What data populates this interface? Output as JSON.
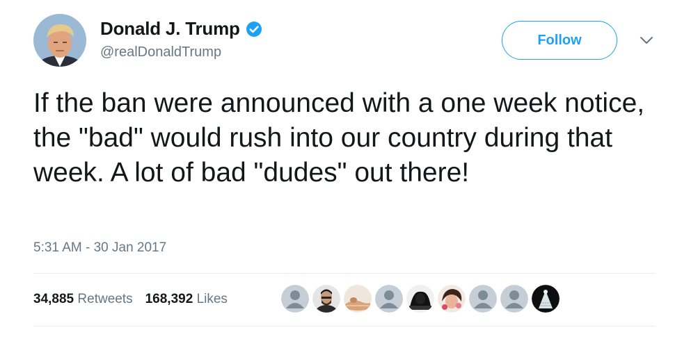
{
  "author": {
    "display_name": "Donald J. Trump",
    "handle": "@realDonaldTrump",
    "verified_icon": "verified-badge-icon"
  },
  "follow_label": "Follow",
  "menu_icon": "chevron-down-icon",
  "tweet_text": "If the ban were announced with a one week notice, the \"bad\" would rush into our country during that week. A lot of bad \"dudes\" out there!",
  "timestamp": "5:31 AM - 30 Jan 2017",
  "stats": {
    "retweets_count": "34,885",
    "retweets_label": "Retweets",
    "likes_count": "168,392",
    "likes_label": "Likes"
  },
  "likers": [
    {
      "icon": "default-avatar-icon"
    },
    {
      "icon": "user-avatar-icon"
    },
    {
      "icon": "user-avatar-icon"
    },
    {
      "icon": "default-avatar-icon"
    },
    {
      "icon": "user-avatar-icon"
    },
    {
      "icon": "user-avatar-icon"
    },
    {
      "icon": "default-avatar-icon"
    },
    {
      "icon": "default-avatar-icon"
    },
    {
      "icon": "user-avatar-icon"
    }
  ],
  "colors": {
    "accent": "#1da1f2",
    "text": "#14171a",
    "secondary_text": "#657786",
    "divider": "#e6ecf0",
    "default_avatar_bg": "#c5ced6"
  }
}
